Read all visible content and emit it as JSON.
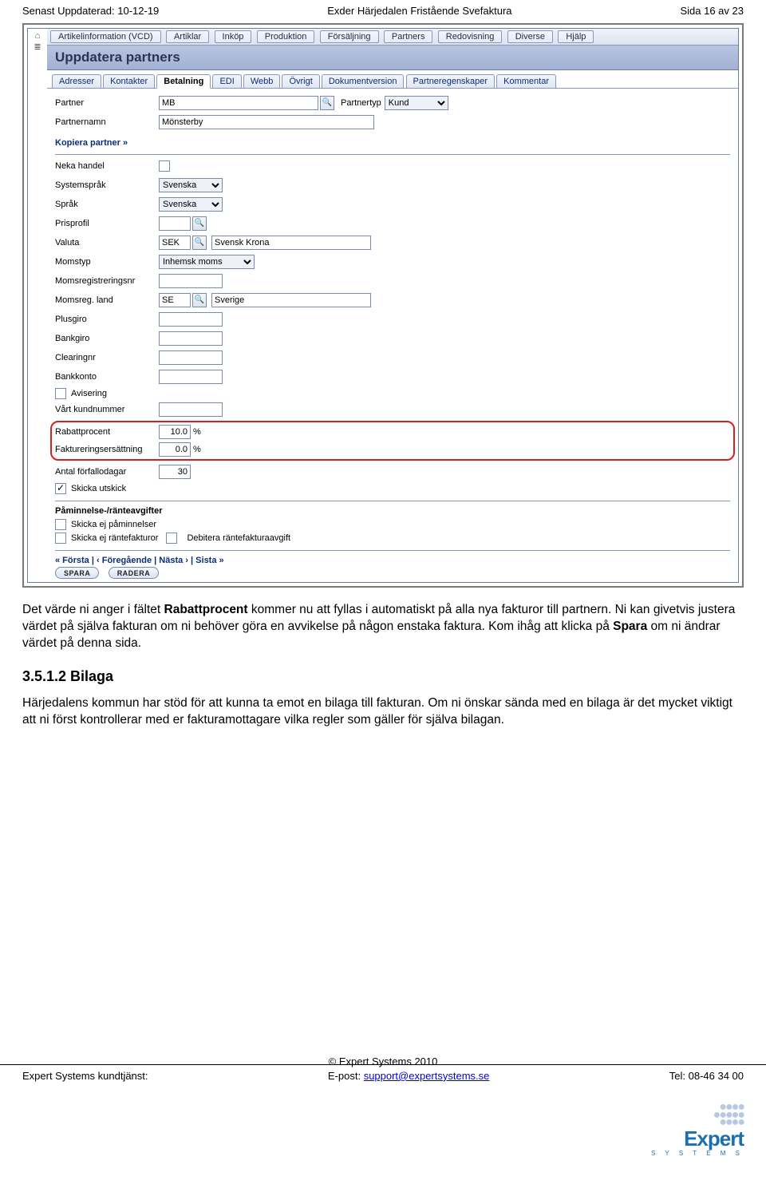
{
  "header": {
    "left": "Senast Uppdaterad: 10-12-19",
    "center": "Exder Härjedalen Fristående Svefaktura",
    "right": "Sida 16 av 23"
  },
  "menubar": [
    "Artikelinformation (VCD)",
    "Artiklar",
    "Inköp",
    "Produktion",
    "Försäljning",
    "Partners",
    "Redovisning",
    "Diverse",
    "Hjälp"
  ],
  "title": "Uppdatera partners",
  "subtabs": [
    "Adresser",
    "Kontakter",
    "Betalning",
    "EDI",
    "Webb",
    "Övrigt",
    "Dokumentversion",
    "Partneregenskaper",
    "Kommentar"
  ],
  "active_subtab": "Betalning",
  "form": {
    "partner_label": "Partner",
    "partner_value": "MB",
    "partnertyp_label": "Partnertyp",
    "partnertyp_value": "Kund",
    "partnernamn_label": "Partnernamn",
    "partnernamn_value": "Mönsterby",
    "kopiera": "Kopiera partner »",
    "neka_handel": "Neka handel",
    "systemsprak": "Systemspråk",
    "systemsprak_val": "Svenska",
    "sprak": "Språk",
    "sprak_val": "Svenska",
    "prisprofil": "Prisprofil",
    "valuta": "Valuta",
    "valuta_code": "SEK",
    "valuta_name": "Svensk Krona",
    "momstyp": "Momstyp",
    "momstyp_val": "Inhemsk moms",
    "momsregnr": "Momsregistreringsnr",
    "momsreg_land": "Momsreg. land",
    "momsreg_land_code": "SE",
    "momsreg_land_name": "Sverige",
    "plusgiro": "Plusgiro",
    "bankgiro": "Bankgiro",
    "clearingnr": "Clearingnr",
    "bankkonto": "Bankkonto",
    "avisering": "Avisering",
    "vart_kundnummer": "Vårt kundnummer",
    "rabattprocent": "Rabattprocent",
    "rabattprocent_val": "10.0",
    "faktureringsersattning": "Faktureringsersättning",
    "faktureringsersattning_val": "0.0",
    "antal_forfallodagar": "Antal förfallodagar",
    "antal_forfallodagar_val": "30",
    "skicka_utskick": "Skicka utskick",
    "paminnelse_section": "Påminnelse-/ränteavgifter",
    "skicka_ej_paminnelser": "Skicka ej påminnelser",
    "skicka_ej_rantefakturor": "Skicka ej räntefakturor",
    "debitera": "Debitera räntefakturaavgift",
    "pager_first": "« Första",
    "pager_prev": "‹ Föregående",
    "pager_next": "Nästa ›",
    "pager_last": "Sista »",
    "btn_spara": "SPARA",
    "btn_radera": "RADERA",
    "percent": "%"
  },
  "body": {
    "p1a": "Det värde ni anger i fältet ",
    "p1b": "Rabattprocent",
    "p1c": " kommer nu att fyllas i automatiskt på alla nya fakturor till partnern. Ni kan givetvis justera värdet på själva fakturan om ni behöver göra en avvikelse på någon enstaka faktura. Kom ihåg att klicka på ",
    "p1d": "Spara",
    "p1e": " om ni ändrar värdet på denna sida.",
    "h3": "3.5.1.2   Bilaga",
    "p2": "Härjedalens kommun har stöd för att kunna ta emot en bilaga till fakturan. Om ni önskar sända med en bilaga är det mycket viktigt att ni först kontrollerar med er fakturamottagare vilka regler som gäller för själva bilagan."
  },
  "footer": {
    "copyright": "© Expert Systems 2010",
    "left": "Expert Systems kundtjänst:",
    "email_label": "E-post: ",
    "email": "support@expertsystems.se",
    "tel": "Tel: 08-46 34 00",
    "logo_word": "Expert",
    "logo_sub": "S Y S T E M S"
  }
}
